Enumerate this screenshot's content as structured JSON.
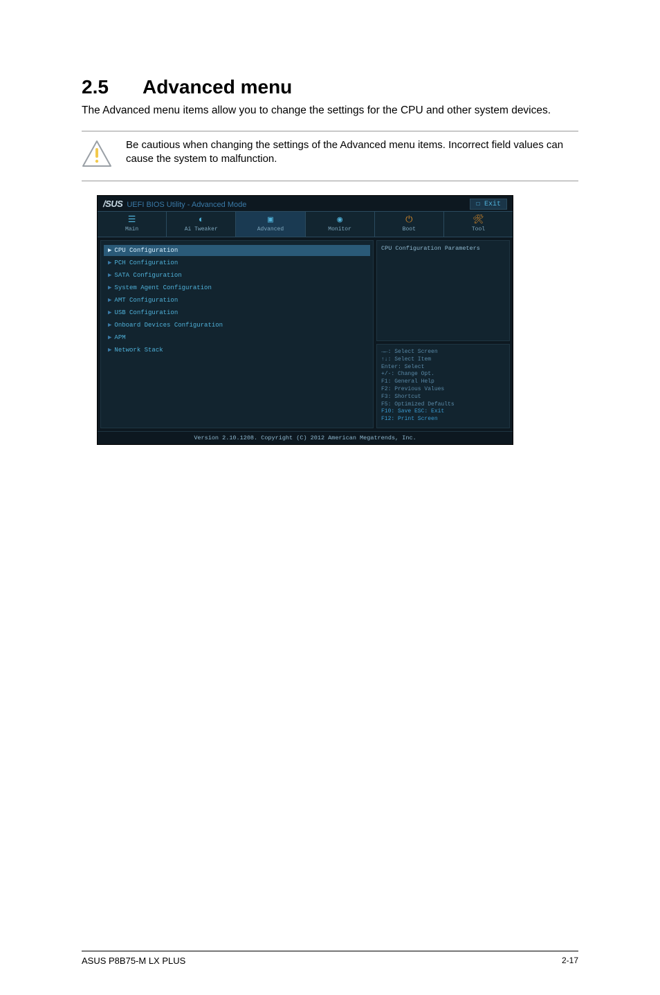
{
  "heading": {
    "number": "2.5",
    "title": "Advanced menu"
  },
  "intro": "The Advanced menu items allow you to change the settings for the CPU and other system devices.",
  "caution": "Be cautious when changing the settings of the Advanced menu items. Incorrect field values can cause the system to malfunction.",
  "bios": {
    "brand": "/SUS",
    "title": "UEFI BIOS Utility - Advanced Mode",
    "exit": "Exit",
    "tabs": {
      "main": "Main",
      "ai": "Ai Tweaker",
      "advanced": "Advanced",
      "monitor": "Monitor",
      "boot": "Boot",
      "tool": "Tool"
    },
    "menu": {
      "cpu": "CPU Configuration",
      "pch": "PCH Configuration",
      "sata": "SATA Configuration",
      "sysagent": "System Agent Configuration",
      "amt": "AMT Configuration",
      "usb": "USB Configuration",
      "onboard": "Onboard Devices Configuration",
      "apm": "APM",
      "net": "Network Stack"
    },
    "help": "CPU Configuration Parameters",
    "keys": {
      "l1": "→←: Select Screen",
      "l2": "↑↓: Select Item",
      "l3": "Enter: Select",
      "l4": "+/-: Change Opt.",
      "l5": "F1: General Help",
      "l6": "F2: Previous Values",
      "l7": "F3: Shortcut",
      "l8": "F5: Optimized Defaults",
      "l9": "F10: Save  ESC: Exit",
      "l10": "F12: Print Screen"
    },
    "version": "Version 2.10.1208. Copyright (C) 2012 American Megatrends, Inc."
  },
  "footer": {
    "left": "ASUS P8B75-M LX PLUS",
    "right": "2-17"
  }
}
